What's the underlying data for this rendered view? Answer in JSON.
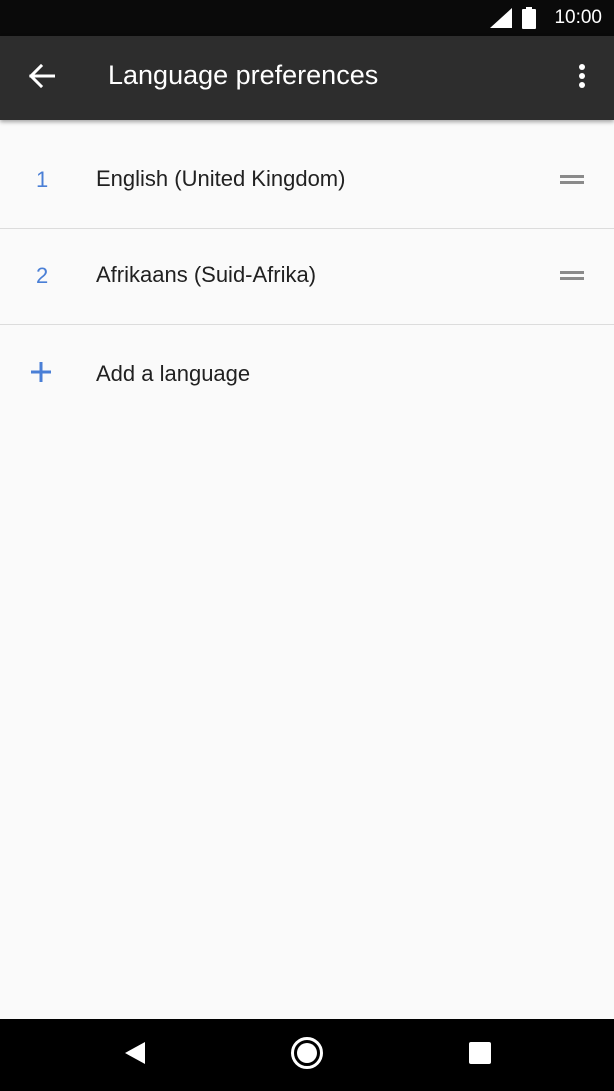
{
  "status_bar": {
    "time": "10:00",
    "icons": [
      "signal-icon",
      "battery-icon"
    ]
  },
  "app_bar": {
    "title": "Language preferences",
    "icons": [
      "arrow-back-icon",
      "more-vert-icon"
    ]
  },
  "languages": [
    {
      "number": "1",
      "label": "English (United Kingdom)"
    },
    {
      "number": "2",
      "label": "Afrikaans (Suid-Afrika)"
    }
  ],
  "add_language": {
    "label": "Add a language",
    "icon": "plus-icon"
  },
  "nav_bar": {
    "icons": [
      "nav-back-icon",
      "nav-home-icon",
      "nav-recents-icon"
    ]
  },
  "colors": {
    "status_bar": "#0a0a0a",
    "app_bar": "#2d2d2d",
    "accent": "#4a7fd6",
    "background": "#fafafa",
    "nav_bar": "#000000"
  }
}
